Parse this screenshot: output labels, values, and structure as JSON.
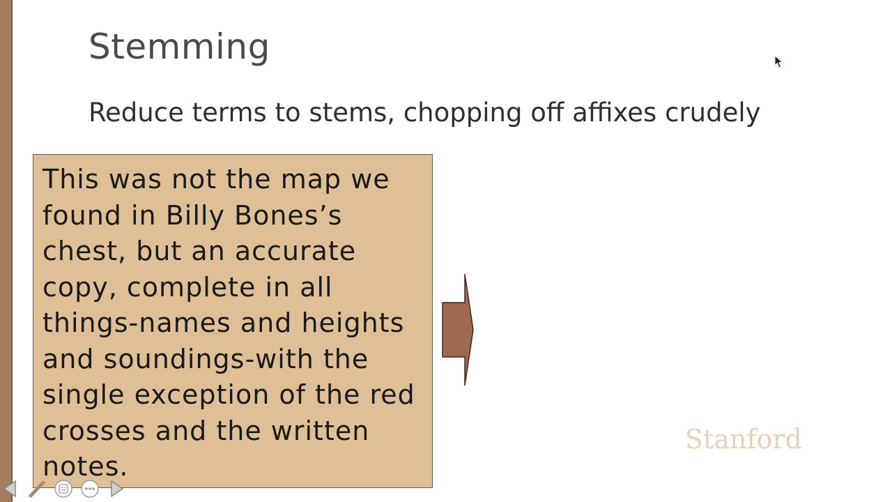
{
  "slide": {
    "title": "Stemming",
    "subtitle": "Reduce terms to stems, chopping off affixes crudely",
    "quote": "This was not the map we found in Billy Bones’s chest, but an accurate copy, complete in all things-names and heights and soundings-with the single exception of the red crosses and the written notes.",
    "logo": "Stanford"
  },
  "colors": {
    "accent_bar": "#a67c5e",
    "quote_box_bg": "#dfbf95",
    "arrow_fill": "#a06a4e",
    "logo_color": "#e6d2bc"
  },
  "icons": {
    "arrow": "right-arrow-icon",
    "cursor": "mouse-pointer-icon",
    "controls": [
      "previous-slide-icon",
      "pen-icon",
      "slides-menu-icon",
      "more-options-icon",
      "next-slide-icon"
    ]
  }
}
